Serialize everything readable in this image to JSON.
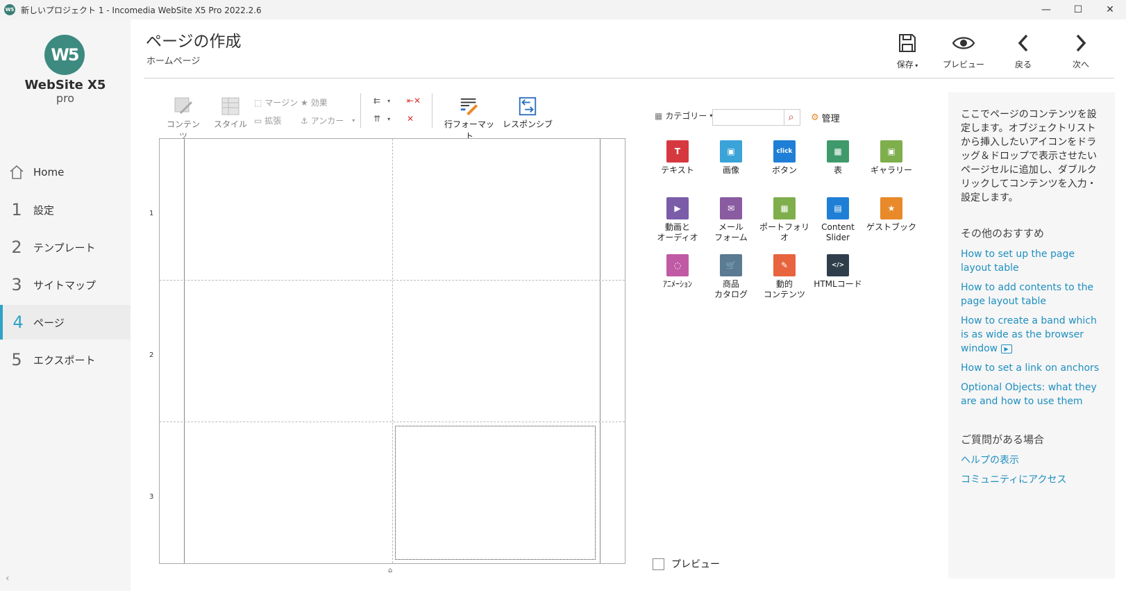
{
  "window": {
    "app_icon_text": "W5",
    "title": "新しいプロジェクト 1 - Incomedia WebSite X5 Pro 2022.2.6",
    "minimize": "—",
    "maximize": "☐",
    "close": "✕"
  },
  "sidebar": {
    "logo_mark": "W5",
    "logo_name": "WebSite X5",
    "logo_edition": "pro",
    "items": [
      {
        "num": "",
        "label": "Home"
      },
      {
        "num": "1",
        "label": "設定"
      },
      {
        "num": "2",
        "label": "テンプレート"
      },
      {
        "num": "3",
        "label": "サイトマップ"
      },
      {
        "num": "4",
        "label": "ページ"
      },
      {
        "num": "5",
        "label": "エクスポート"
      }
    ],
    "active_index": 4,
    "collapse": "‹"
  },
  "header": {
    "title": "ページの作成",
    "subtitle": "ホームページ",
    "buttons": {
      "save": "保存",
      "preview": "プレビュー",
      "back": "戻る",
      "next": "次へ"
    }
  },
  "toolbar": {
    "content": "コンテンツ",
    "style": "スタイル",
    "margin": "マージン",
    "effect": "効果",
    "expand": "拡張",
    "anchor": "アンカー",
    "row_format": "行フォーマット",
    "responsive": "レスポンシブ"
  },
  "grid": {
    "rows": [
      "1",
      "2",
      "3"
    ],
    "handle": "⌂"
  },
  "objects": {
    "category_label": "カテゴリー",
    "search_placeholder": "",
    "manage_label": "管理",
    "items": [
      {
        "label": "テキスト",
        "icon": "text-icon",
        "color": "#d6383f",
        "glyph": "T"
      },
      {
        "label": "画像",
        "icon": "image-icon",
        "color": "#3aa3d8",
        "glyph": "▣"
      },
      {
        "label": "ボタン",
        "icon": "button-icon",
        "color": "#1f7fd6",
        "glyph": "click"
      },
      {
        "label": "表",
        "icon": "table-icon",
        "color": "#3f9a6b",
        "glyph": "▦"
      },
      {
        "label": "ギャラリー",
        "icon": "gallery-icon",
        "color": "#7fae4d",
        "glyph": "▣"
      },
      {
        "label": "動画と\nオーディオ",
        "icon": "video-audio-icon",
        "color": "#7b5ca8",
        "glyph": "▶"
      },
      {
        "label": "メール\nフォーム",
        "icon": "mail-form-icon",
        "color": "#8a5ba0",
        "glyph": "✉"
      },
      {
        "label": "ポートフォリオ",
        "icon": "portfolio-icon",
        "color": "#7fae4d",
        "glyph": "▦"
      },
      {
        "label": "Content\nSlider",
        "icon": "content-slider-icon",
        "color": "#1f7fd6",
        "glyph": "▤"
      },
      {
        "label": "ゲストブック",
        "icon": "guestbook-icon",
        "color": "#e8892a",
        "glyph": "★"
      },
      {
        "label": "ｱﾆﾒｰｼｮﾝ",
        "icon": "animation-icon",
        "color": "#c05aa5",
        "glyph": "◌"
      },
      {
        "label": "商品\nカタログ",
        "icon": "product-catalog-icon",
        "color": "#5a7b91",
        "glyph": "🛒"
      },
      {
        "label": "動的\nコンテンツ",
        "icon": "dynamic-content-icon",
        "color": "#e7643f",
        "glyph": "✎"
      },
      {
        "label": "HTMLコード",
        "icon": "html-code-icon",
        "color": "#2f3e4a",
        "glyph": "</>"
      }
    ],
    "preview_label": "プレビュー"
  },
  "help": {
    "intro": "ここでページのコンテンツを設定します。オブジェクトリストから挿入したいアイコンをドラッグ＆ドロップで表示させたいページセルに追加し、ダブルクリックしてコンテンツを入力・設定します。",
    "recommend_heading": "その他のおすすめ",
    "links": [
      "How to set up the page layout table",
      "How to add contents to the page layout table",
      "How to create a band which is as wide as the browser window",
      "How to set a link on anchors",
      "Optional Objects: what they are and how to use them"
    ],
    "question_heading": "ご質問がある場合",
    "support_links": [
      "ヘルプの表示",
      "コミュニティにアクセス"
    ]
  }
}
